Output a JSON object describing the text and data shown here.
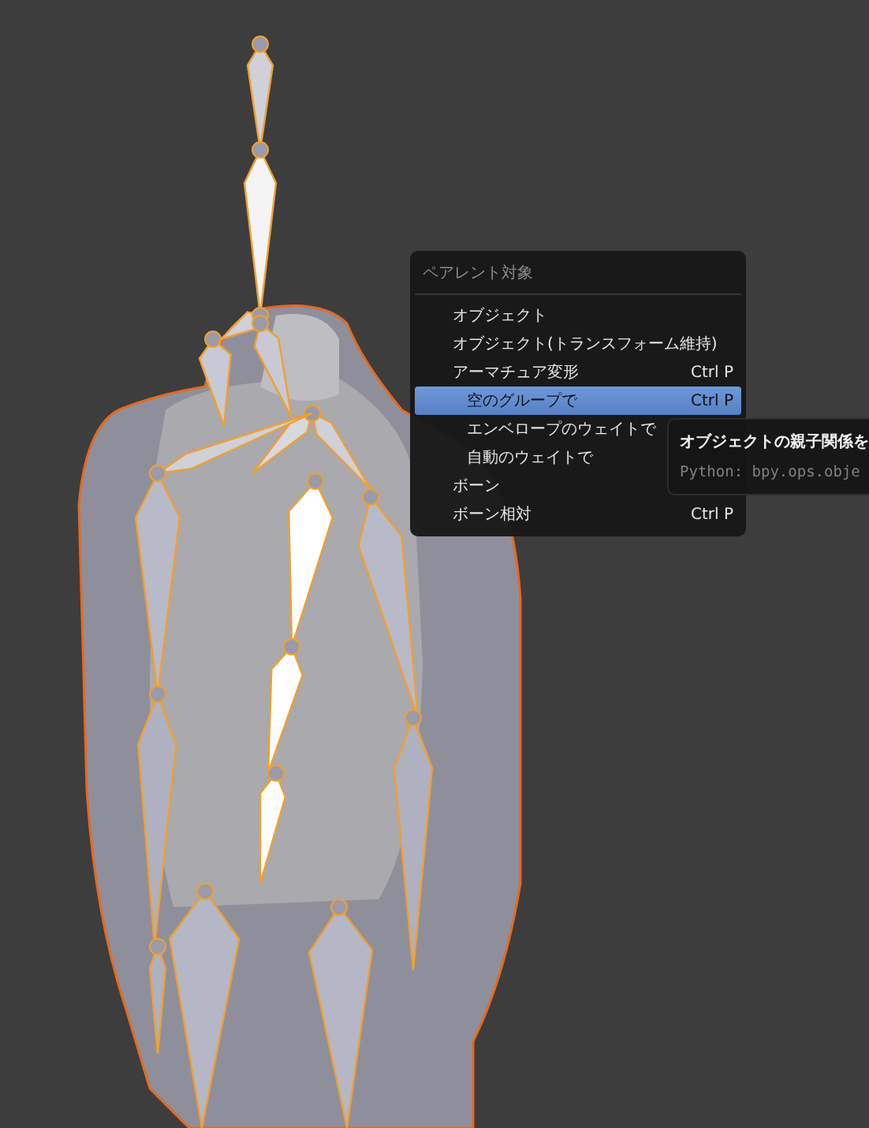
{
  "menu": {
    "title": "ペアレント対象",
    "items": [
      {
        "label": "オブジェクト",
        "selected": false
      },
      {
        "label": "オブジェクト(トランスフォーム維持)",
        "selected": false
      },
      {
        "label": "アーマチュア変形",
        "shortcut": "Ctrl P",
        "selected": false,
        "children": [
          {
            "label": "空のグループで",
            "shortcut": "Ctrl P",
            "selected": true
          },
          {
            "label": "エンベロープのウェイトで",
            "selected": false
          },
          {
            "label": "自動のウェイトで",
            "selected": false
          }
        ]
      },
      {
        "label": "ボーン",
        "selected": false
      },
      {
        "label": "ボーン相対",
        "shortcut": "Ctrl P",
        "selected": false
      }
    ]
  },
  "tooltip": {
    "title": "オブジェクトの親子関係を",
    "python": "Python: bpy.ops.obje"
  }
}
